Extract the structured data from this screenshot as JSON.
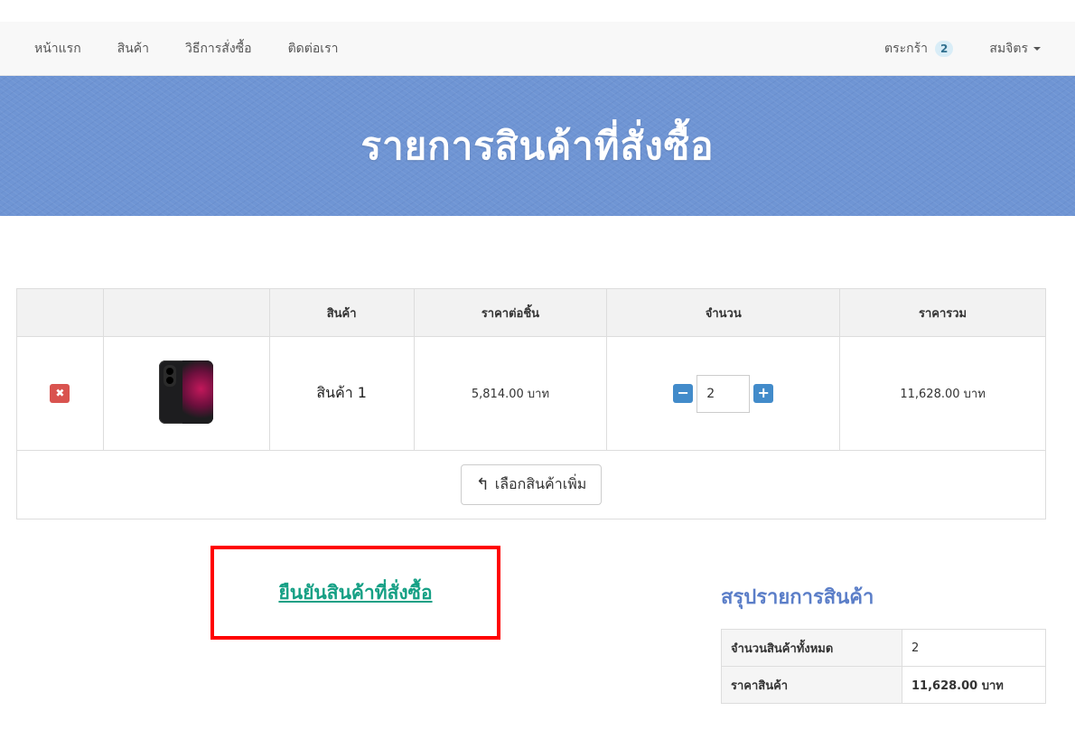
{
  "nav": {
    "items": [
      {
        "label": "หน้าแรก",
        "name": "nav-home"
      },
      {
        "label": "สินค้า",
        "name": "nav-products"
      },
      {
        "label": "วิธีการสั่งซื้อ",
        "name": "nav-how-to-order"
      },
      {
        "label": "ติดต่อเรา",
        "name": "nav-contact"
      }
    ],
    "cart_label": "ตระกร้า",
    "cart_count": "2",
    "user_label": "สมจิตร"
  },
  "banner": {
    "title": "รายการสินค้าที่สั่งซื้อ"
  },
  "cart": {
    "headers": [
      "",
      "",
      "สินค้า",
      "ราคาต่อชิ้น",
      "จำนวน",
      "ราคารวม"
    ],
    "rows": [
      {
        "remove_icon": "times-icon",
        "image_icon": "smartphone-image",
        "product": "สินค้า 1",
        "unit_price": "5,814.00 บาท",
        "quantity": "2",
        "total": "11,628.00 บาท"
      }
    ],
    "continue_button": "เลือกสินค้าเพิ่ม",
    "continue_icon": "reply-arrow-icon"
  },
  "confirm_link": "ยืนยันสินค้าที่สั่งซื้อ",
  "summary": {
    "title": "สรุปรายการสินค้า",
    "rows": [
      {
        "label": "จำนวนสินค้าทั้งหมด",
        "value": "2"
      },
      {
        "label": "ราคาสินค้า",
        "value": "11,628.00 บาท"
      }
    ]
  },
  "colors": {
    "banner": "#6f95d4",
    "remove": "#d9534f",
    "qty_button": "#428bca",
    "confirm_link": "#16a085",
    "highlight_border": "#ff0000",
    "summary_title": "#5b7ec8"
  }
}
